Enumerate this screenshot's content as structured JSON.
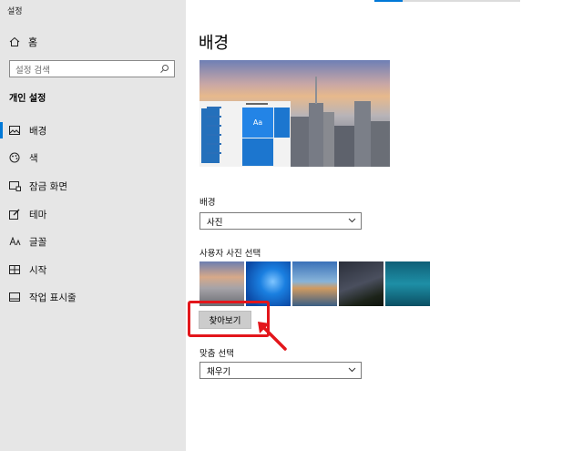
{
  "app": {
    "title": "설정"
  },
  "sidebar": {
    "home_label": "홈",
    "search_placeholder": "설정 검색",
    "section_title": "개인 설정",
    "items": [
      {
        "label": "배경",
        "icon": "picture-icon",
        "active": true
      },
      {
        "label": "색",
        "icon": "palette-icon",
        "active": false
      },
      {
        "label": "잠금 화면",
        "icon": "lock-screen-icon",
        "active": false
      },
      {
        "label": "테마",
        "icon": "brush-icon",
        "active": false
      },
      {
        "label": "글꼴",
        "icon": "font-icon",
        "active": false
      },
      {
        "label": "시작",
        "icon": "start-icon",
        "active": false
      },
      {
        "label": "작업 표시줄",
        "icon": "taskbar-icon",
        "active": false
      }
    ]
  },
  "main": {
    "title": "배경",
    "preview": {
      "tile_text": "Aa"
    },
    "background": {
      "label": "배경",
      "value": "사진"
    },
    "choose_picture": {
      "label": "사용자 사진 선택",
      "thumbnails": [
        "city-dusk",
        "windows-blue",
        "beach-rocks",
        "night-sky-tent",
        "underwater-diver"
      ],
      "browse_label": "찾아보기"
    },
    "fit": {
      "label": "맞춤 선택",
      "value": "채우기"
    }
  },
  "colors": {
    "accent": "#0078d7",
    "highlight": "#e3161b",
    "sidebar_bg": "#e6e6e6"
  }
}
